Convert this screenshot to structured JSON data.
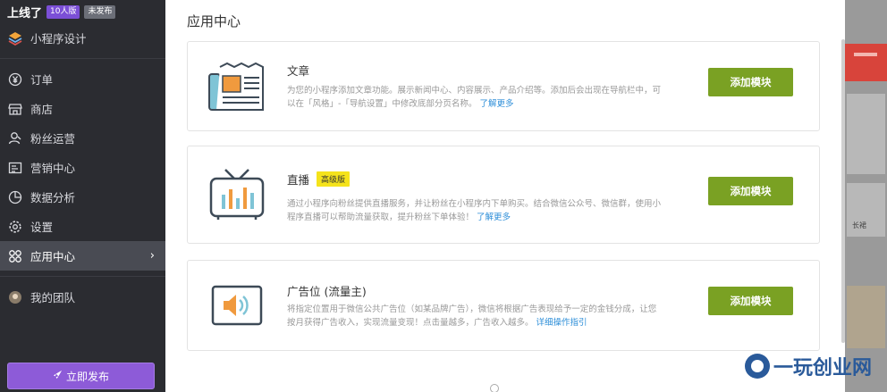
{
  "brand": {
    "name": "上线了",
    "plan_badge": "10人版",
    "status_badge": "未发布"
  },
  "sidebar": {
    "items": [
      {
        "label": "小程序设计",
        "icon": "layers-icon"
      },
      {
        "label": "订单",
        "icon": "yen-icon"
      },
      {
        "label": "商店",
        "icon": "store-icon"
      },
      {
        "label": "粉丝运营",
        "icon": "fans-icon"
      },
      {
        "label": "营销中心",
        "icon": "marketing-icon"
      },
      {
        "label": "数据分析",
        "icon": "pie-chart-icon"
      },
      {
        "label": "设置",
        "icon": "gear-icon"
      },
      {
        "label": "应用中心",
        "icon": "apps-icon",
        "active": true
      },
      {
        "label": "我的团队",
        "icon": "team-avatar-icon"
      }
    ],
    "publish_label": "立即发布"
  },
  "panel": {
    "title": "应用中心",
    "cards": [
      {
        "name": "文章",
        "desc": "为您的小程序添加文章功能。展示新闻中心、内容展示、产品介绍等。添加后会出现在导航栏中，可以在「风格」-「导航设置」中修改底部分页名称。",
        "link": "了解更多",
        "button": "添加模块",
        "icon": "newspaper-icon"
      },
      {
        "name": "直播",
        "tag": "高级版",
        "desc": "通过小程序向粉丝提供直播服务，并让粉丝在小程序内下单购买。结合微信公众号、微信群，使用小程序直播可以帮助流量获取，提升粉丝下单体验！",
        "link": "了解更多",
        "button": "添加模块",
        "icon": "tv-icon"
      },
      {
        "name": "广告位 (流量主)",
        "desc": "将指定位置用于微信公共广告位（如某品牌广告），微信将根据广告表现给予一定的金钱分成，让您按月获得广告收入，实现流量变现！点击量越多，广告收入越多。",
        "link": "详细操作指引",
        "button": "添加模块",
        "icon": "speaker-icon"
      }
    ]
  },
  "backdrop": {
    "tiny_label": "长裙"
  },
  "watermark": {
    "text": "一玩创业网"
  },
  "colors": {
    "sidebar_bg": "#2b2c31",
    "accent_purple": "#8d5bd8",
    "button_green": "#7aa123",
    "link_blue": "#2d8ed8",
    "tag_yellow": "#f5e31b"
  }
}
